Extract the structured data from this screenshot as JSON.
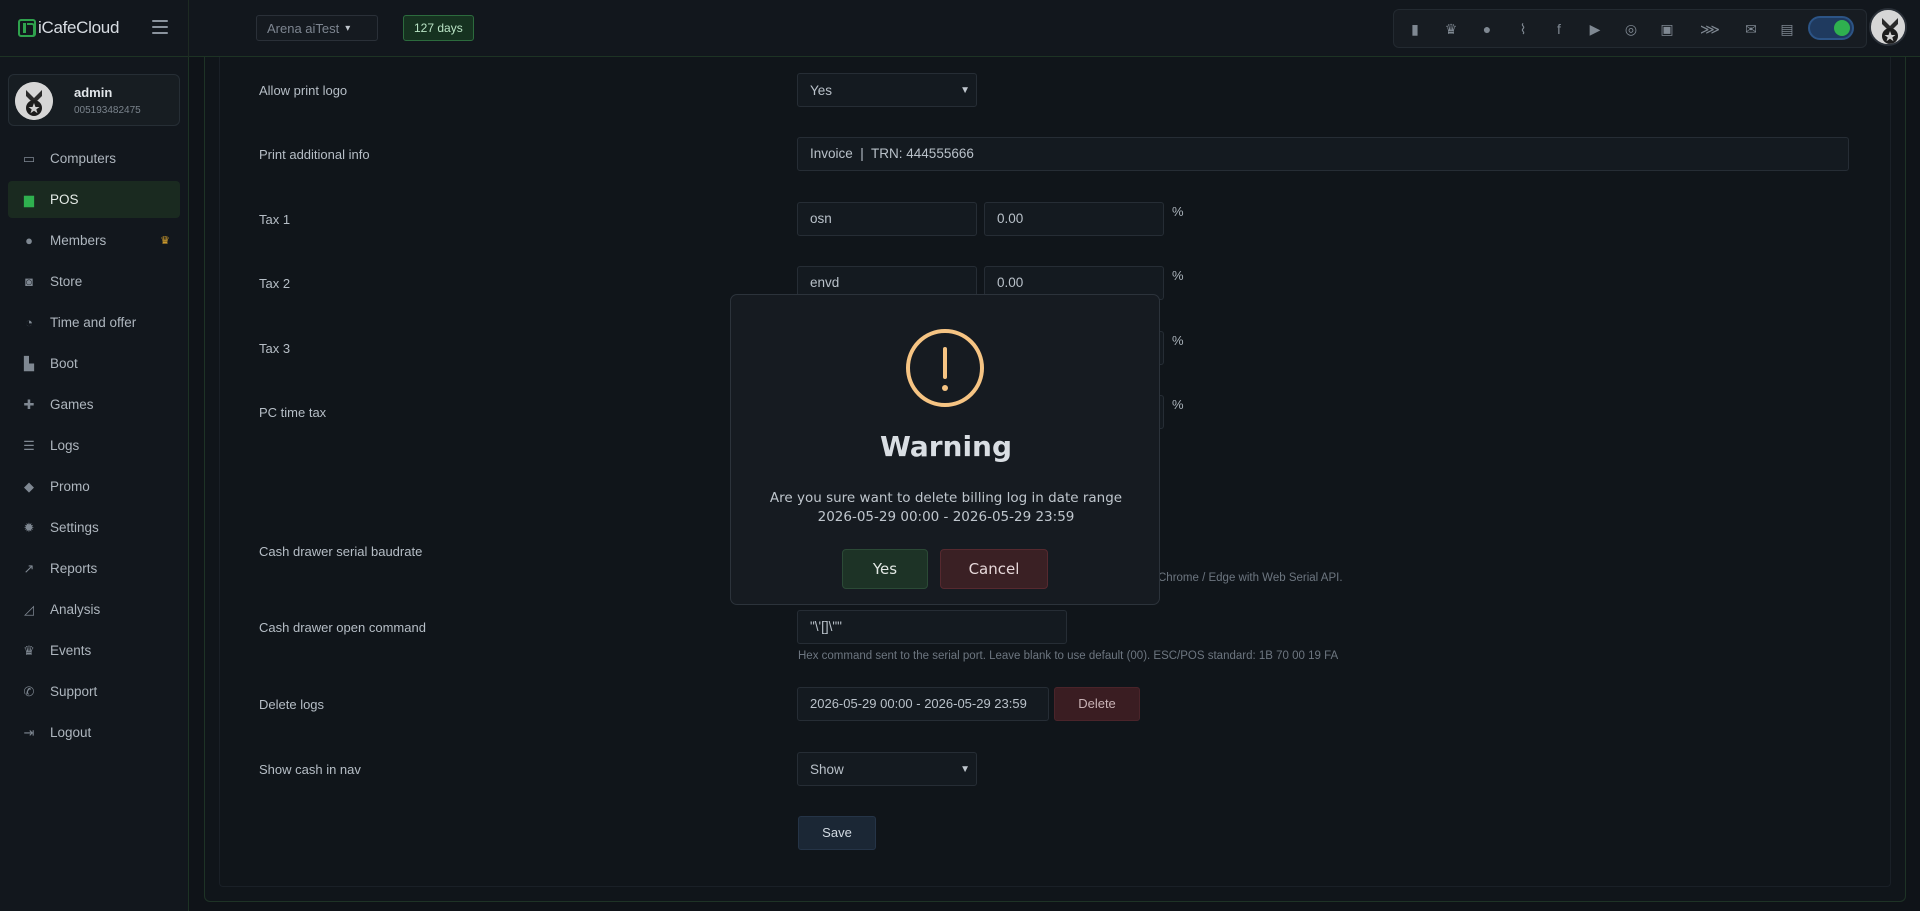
{
  "app": {
    "logo_text": "iCafeCloud"
  },
  "topbar": {
    "arena_select": "Arena aiTest",
    "days_badge": "127 days",
    "icons": [
      "leaderboard-icon",
      "trophy-icon",
      "group-icon",
      "rss-icon",
      "facebook-icon",
      "youtube-icon",
      "globe-icon",
      "icafe-icon",
      "handshake-icon",
      "mail-icon",
      "chat-icon"
    ],
    "toggle_on": true
  },
  "user": {
    "name": "admin",
    "id": "005193482475"
  },
  "nav": {
    "items": [
      {
        "label": "Computers",
        "icon": "monitor-icon"
      },
      {
        "label": "POS",
        "icon": "cashier-icon",
        "active": true
      },
      {
        "label": "Members",
        "icon": "members-icon",
        "badge": "crown-icon"
      },
      {
        "label": "Store",
        "icon": "bag-icon"
      },
      {
        "label": "Time and offer",
        "icon": "stopwatch-icon"
      },
      {
        "label": "Boot",
        "icon": "boot-icon"
      },
      {
        "label": "Games",
        "icon": "gamepad-icon"
      },
      {
        "label": "Logs",
        "icon": "list-icon"
      },
      {
        "label": "Promo",
        "icon": "tag-icon"
      },
      {
        "label": "Settings",
        "icon": "gear-icon"
      },
      {
        "label": "Reports",
        "icon": "chart-line-icon"
      },
      {
        "label": "Analysis",
        "icon": "analysis-icon"
      },
      {
        "label": "Events",
        "icon": "crown-icon"
      },
      {
        "label": "Support",
        "icon": "phone-icon"
      },
      {
        "label": "Logout",
        "icon": "logout-icon"
      }
    ]
  },
  "form": {
    "allow_print_logo": {
      "label": "Allow print logo",
      "value": "Yes"
    },
    "print_additional_info": {
      "label": "Print additional info",
      "value": "Invoice  |  TRN: 444555666"
    },
    "tax1": {
      "label": "Tax 1",
      "name": "osn",
      "rate": "0.00",
      "unit": "%"
    },
    "tax2": {
      "label": "Tax 2",
      "name": "envd",
      "rate": "0.00",
      "unit": "%"
    },
    "tax3": {
      "label": "Tax 3",
      "unit": "%"
    },
    "pc_time_tax": {
      "label": "PC time tax",
      "unit": "%"
    },
    "cash_drawer_baudrate": {
      "label": "Cash drawer serial baudrate",
      "help": "Chrome / Edge with Web Serial API."
    },
    "cash_drawer_command": {
      "label": "Cash drawer open command",
      "value": "\"\\'[]\\\"\"",
      "help": "Hex command sent to the serial port. Leave blank to use default (00). ESC/POS standard: 1B 70 00 19 FA"
    },
    "delete_logs": {
      "label": "Delete logs",
      "range": "2026-05-29 00:00 - 2026-05-29 23:59",
      "button": "Delete"
    },
    "show_cash_in_nav": {
      "label": "Show cash in nav",
      "value": "Show"
    },
    "save_button": "Save"
  },
  "modal": {
    "title": "Warning",
    "message_line1": "Are you sure want to delete billing log in date range",
    "message_line2": "2026-05-29 00:00 - 2026-05-29 23:59",
    "yes": "Yes",
    "cancel": "Cancel"
  }
}
